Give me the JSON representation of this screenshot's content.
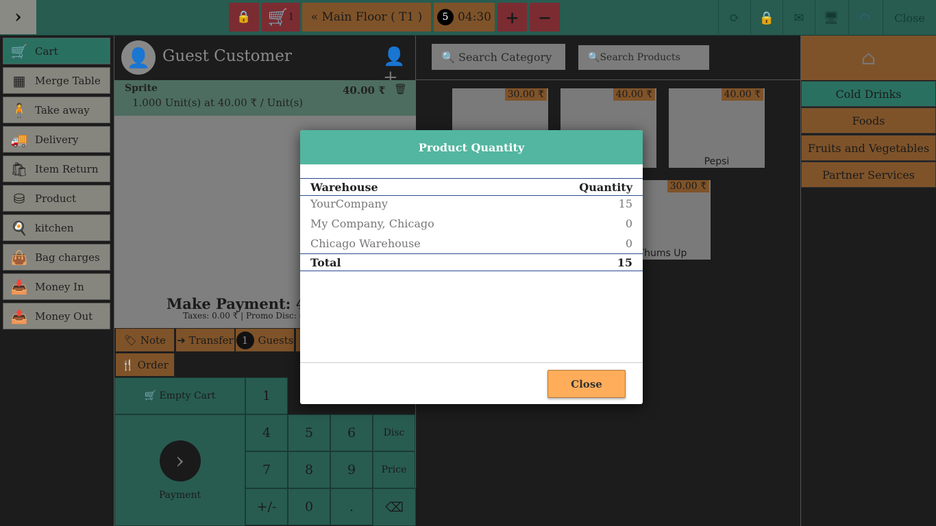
{
  "topbar": {
    "cart_count": "1",
    "floor": "Main Floor ( T1 )",
    "guests_badge": "5",
    "time": "04:30",
    "close": "Close"
  },
  "sidebar": [
    {
      "label": "Cart",
      "icon": "🛒"
    },
    {
      "label": "Merge Table",
      "icon": "▦"
    },
    {
      "label": "Take away",
      "icon": "🧍"
    },
    {
      "label": "Delivery",
      "icon": "🚚"
    },
    {
      "label": "Item Return",
      "icon": "🛍"
    },
    {
      "label": "Product",
      "icon": "⛁"
    },
    {
      "label": "kitchen",
      "icon": "🍳"
    },
    {
      "label": "Bag charges",
      "icon": "👜"
    },
    {
      "label": "Money In",
      "icon": "📥"
    },
    {
      "label": "Money Out",
      "icon": "📤"
    }
  ],
  "customer": {
    "name": "Guest Customer"
  },
  "order_line": {
    "product": "Sprite",
    "price": "40.00 ₹",
    "detail": "1.000 Unit(s) at 40.00 ₹ / Unit(s)"
  },
  "payment": {
    "title": "Make Payment: 4",
    "taxes": "Taxes: 0.00 ₹",
    "promo": "Promo Disc: ("
  },
  "actions": {
    "note": "Note",
    "transfer": "Transfer",
    "guests_count": "1",
    "guests": "Guests",
    "order": "Order",
    "empty_cart": "Empty Cart",
    "payment": "Payment"
  },
  "numpad": [
    "1",
    "4",
    "5",
    "6",
    "Disc",
    "7",
    "8",
    "9",
    "Price",
    "+/-",
    "0",
    "."
  ],
  "search": {
    "category": "Search Category",
    "products": "Search Products"
  },
  "products": [
    {
      "name": "",
      "price": "30.00 ₹"
    },
    {
      "name": "",
      "price": "40.00 ₹"
    },
    {
      "name": "Pepsi",
      "price": "40.00 ₹"
    },
    {
      "name": "Thums Up",
      "price": "30.00 ₹"
    }
  ],
  "categories": [
    "Cold Drinks",
    "Foods",
    "Fruits and Vegetables",
    "Partner Services"
  ],
  "modal": {
    "title": "Product Quantity",
    "col_warehouse": "Warehouse",
    "col_quantity": "Quantity",
    "rows": [
      {
        "warehouse": "YourCompany",
        "qty": "15"
      },
      {
        "warehouse": "My Company, Chicago",
        "qty": "0"
      },
      {
        "warehouse": "Chicago Warehouse",
        "qty": "0"
      }
    ],
    "total_label": "Total",
    "total": "15",
    "close": "Close"
  }
}
